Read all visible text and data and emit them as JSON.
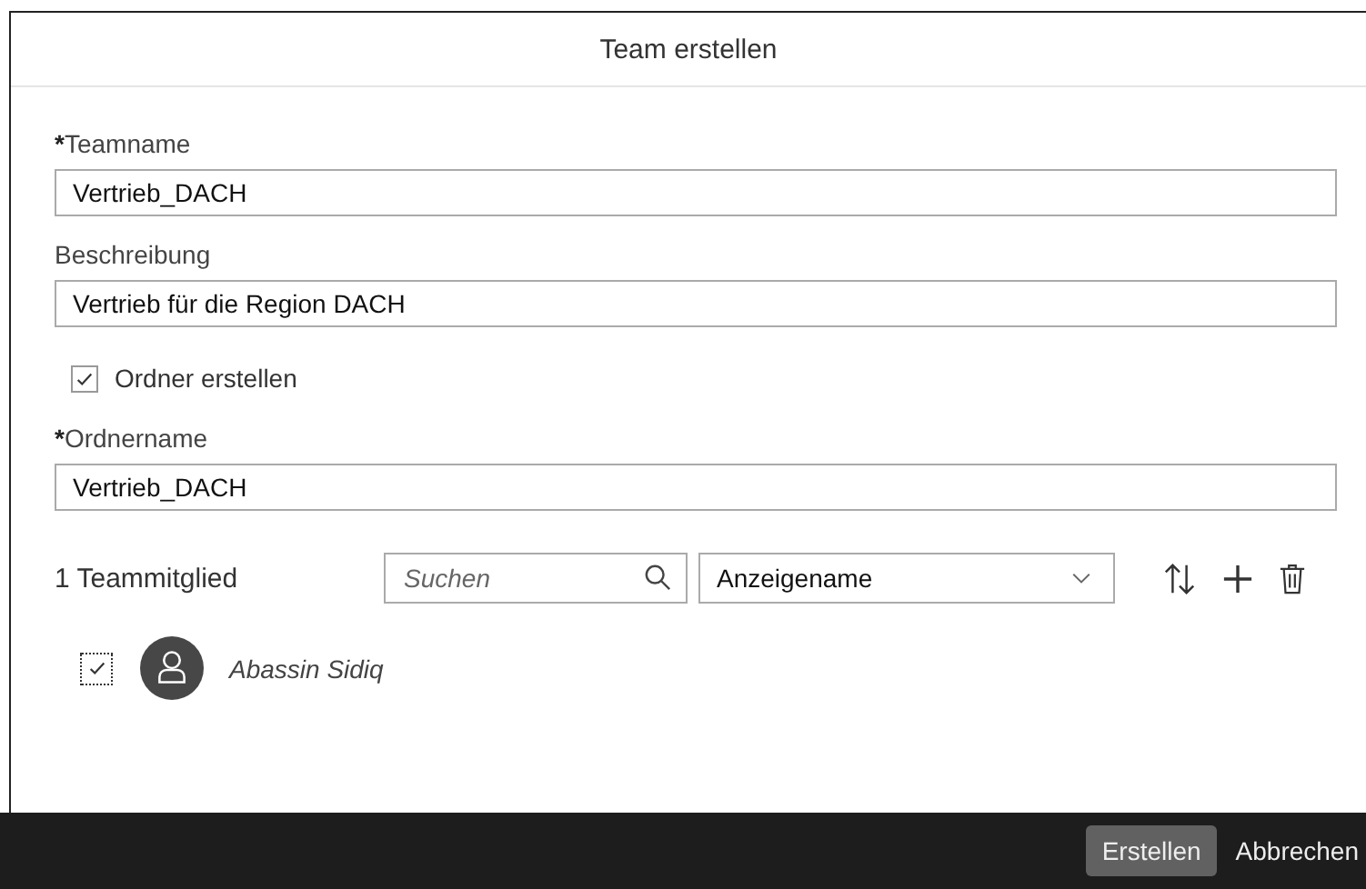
{
  "dialog": {
    "title": "Team erstellen"
  },
  "fields": [
    {
      "label": "Teamname",
      "required_mark": "*",
      "value": "Vertrieb_DACH"
    },
    {
      "label": "Beschreibung",
      "value": "Vertrieb für die Region DACH"
    }
  ],
  "folder_checkbox": {
    "label": "Ordner erstellen",
    "checked": true
  },
  "folder_field": {
    "label": "Ordnername",
    "required_mark": "*",
    "value": "Vertrieb_DACH"
  },
  "members": {
    "count_label": "1 Teammitglied",
    "search": {
      "placeholder": "Suchen"
    },
    "sort_select": {
      "value": "Anzeigename"
    },
    "rows": [
      {
        "name": "Abassin Sidiq",
        "checked": true
      }
    ]
  },
  "footer": {
    "buttons": [
      {
        "label": "Erstellen",
        "kind": "primary"
      },
      {
        "label": "Abbrechen",
        "kind": "plain"
      }
    ]
  }
}
